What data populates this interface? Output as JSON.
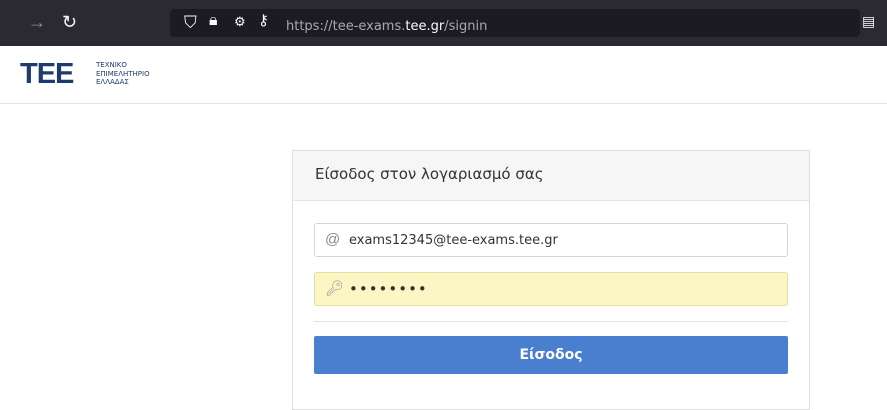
{
  "browser": {
    "url_prefix": "https://tee-exams.",
    "url_domain": "tee.gr",
    "url_path": "/signin"
  },
  "header": {
    "logo_mark": "TEE",
    "logo_line1": "ΤΕΧΝΙΚΟ",
    "logo_line2": "ΕΠΙΜΕΛΗΤΗΡΙΟ",
    "logo_line3": "ΕΛΛΑΔΑΣ"
  },
  "login": {
    "title": "Είσοδος στον λογαριασμό σας",
    "email_value": "exams12345@tee-exams.tee.gr",
    "password_value": "••••••••",
    "submit_label": "Είσοδος"
  },
  "colors": {
    "brand": "#1d3b6e",
    "button": "#4a7fcf",
    "autofill": "#fbf6c3"
  }
}
